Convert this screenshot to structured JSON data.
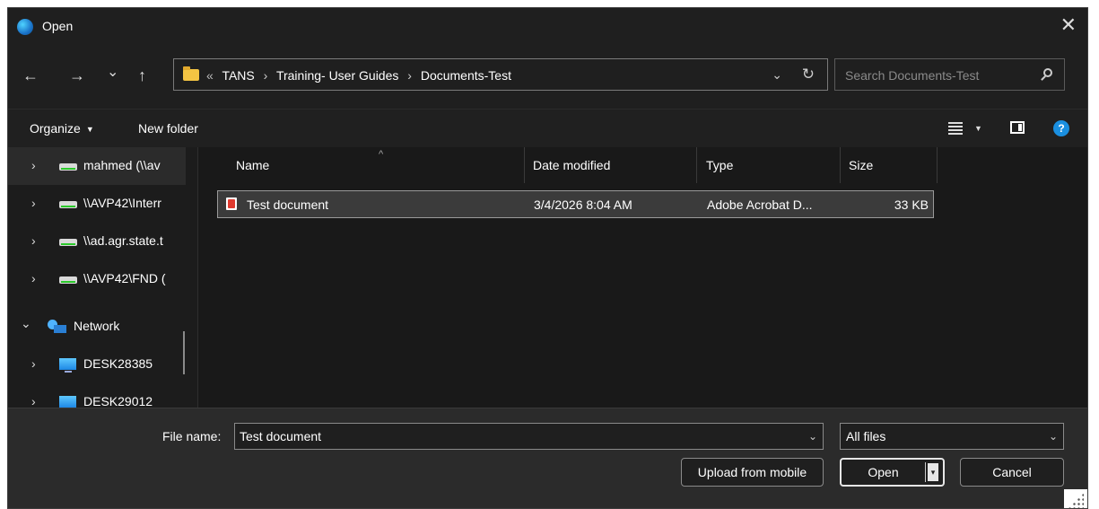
{
  "window": {
    "title": "Open",
    "close_glyph": "✕",
    "icon": "edge-browser-icon"
  },
  "nav": {
    "back": "←",
    "forward": "→",
    "recent": "⌄",
    "up": "↑",
    "breadcrumb_overflow": "«",
    "breadcrumbs": [
      "TANS",
      "Training- User Guides",
      "Documents-Test"
    ],
    "breadcrumb_sep": "›",
    "dropdown": "⌄",
    "refresh": "↻"
  },
  "search": {
    "placeholder": "Search Documents-Test"
  },
  "toolbar": {
    "organize": "Organize",
    "new_folder": "New folder",
    "caret": "▼",
    "help": "?"
  },
  "sidebar": {
    "items": [
      {
        "label": "mahmed (\\\\av",
        "chevron": "›",
        "icon": "network-drive-icon"
      },
      {
        "label": "\\\\AVP42\\Interr",
        "chevron": "›",
        "icon": "network-drive-icon"
      },
      {
        "label": "\\\\ad.agr.state.t",
        "chevron": "›",
        "icon": "network-drive-icon"
      },
      {
        "label": "\\\\AVP42\\FND (",
        "chevron": "›",
        "icon": "network-drive-icon"
      },
      {
        "label": "Network",
        "chevron": "⌄",
        "icon": "network-icon"
      },
      {
        "label": "DESK28385",
        "chevron": "›",
        "icon": "computer-icon"
      },
      {
        "label": "DESK29012",
        "chevron": "›",
        "icon": "computer-icon"
      }
    ]
  },
  "filelist": {
    "columns": {
      "name": "Name",
      "date": "Date modified",
      "type": "Type",
      "size": "Size"
    },
    "sort_caret": "^",
    "rows": [
      {
        "name": "Test document",
        "date": "3/4/2026 8:04 AM",
        "type": "Adobe Acrobat D...",
        "size": "33 KB",
        "icon": "pdf-icon"
      }
    ]
  },
  "bottom": {
    "file_name_label": "File name:",
    "file_name_value": "Test document",
    "file_type": "All files",
    "upload_button": "Upload from mobile",
    "open_button": "Open",
    "open_arrow": "▾",
    "cancel_button": "Cancel",
    "dropdown_chevron": "⌄"
  },
  "colors": {
    "background": "#1f1f1f",
    "selection": "#3b3b3b",
    "accent": "#1a8fe0",
    "folder": "#f3c443"
  }
}
